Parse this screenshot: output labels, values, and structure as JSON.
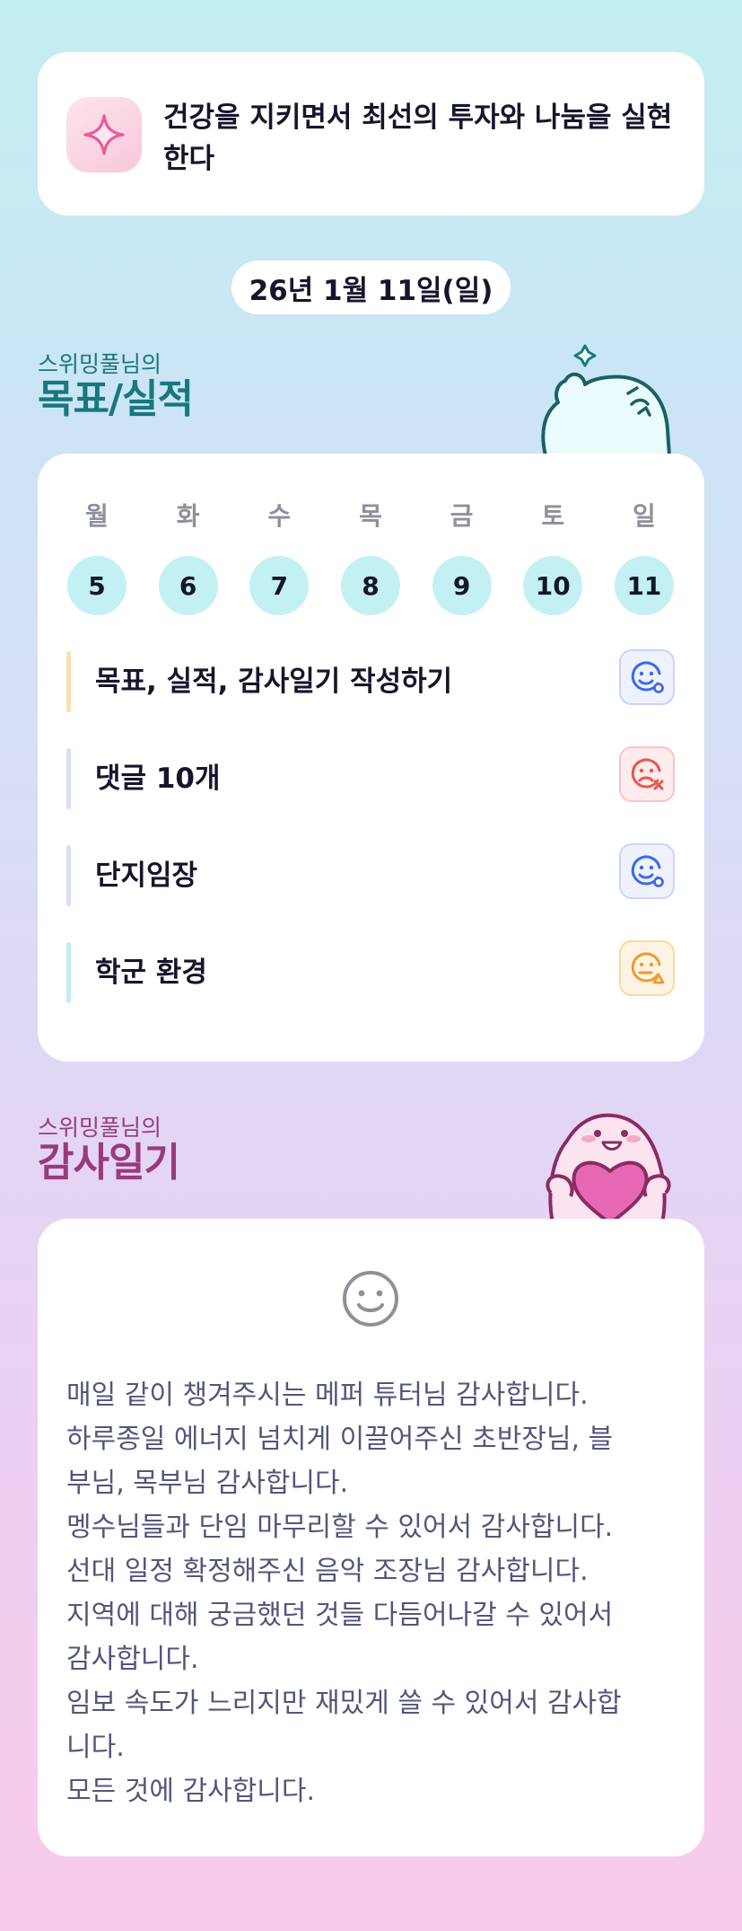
{
  "goal": {
    "icon": "sparkle-icon",
    "text": "건강을 지키면서 최선의 투자와 나눔을 실현한다"
  },
  "date": "26년 1월 11일(일)",
  "goals_section": {
    "subtitle": "스위밍풀님의",
    "title": "목표/실적",
    "mascot": "winking-mascot"
  },
  "week": {
    "days": [
      {
        "name": "월",
        "num": "5"
      },
      {
        "name": "화",
        "num": "6"
      },
      {
        "name": "수",
        "num": "7"
      },
      {
        "name": "목",
        "num": "8"
      },
      {
        "name": "금",
        "num": "9"
      },
      {
        "name": "토",
        "num": "10"
      },
      {
        "name": "일",
        "num": "11"
      }
    ]
  },
  "tasks": [
    {
      "label": "목표, 실적, 감사일기 작성하기",
      "bar_color": "#fbe0b0",
      "status": "done",
      "icon": "smile-circle-icon",
      "badge_bg": "#eef2ff",
      "badge_border": "#c9d4f7",
      "icon_color": "#3d6ae8"
    },
    {
      "label": "댓글 10개",
      "bar_color": "#d8dff7",
      "status": "failed",
      "icon": "sad-x-icon",
      "badge_bg": "#ffecec",
      "badge_border": "#f6c4c4",
      "icon_color": "#e8574f"
    },
    {
      "label": "단지임장",
      "bar_color": "#d8dff7",
      "status": "done",
      "icon": "smile-circle-icon",
      "badge_bg": "#eef2ff",
      "badge_border": "#c9d4f7",
      "icon_color": "#3d6ae8"
    },
    {
      "label": "학군 환경",
      "bar_color": "#c3eef2",
      "status": "partial",
      "icon": "neutral-triangle-icon",
      "badge_bg": "#fff4e4",
      "badge_border": "#f8d8a8",
      "icon_color": "#f29a2e"
    }
  ],
  "diary_section": {
    "subtitle": "스위밍풀님의",
    "title": "감사일기",
    "mascot": "heart-mascot"
  },
  "diary": {
    "icon": "smile-face-icon",
    "lines": [
      "매일 같이 챙겨주시는 메퍼 튜터님 감사합니다.",
      "하루종일 에너지 넘치게 이끌어주신 초반장님, 블",
      "부님, 목부님 감사합니다.",
      "멩수님들과 단임 마무리할 수 있어서 감사합니다.",
      "선대 일정 확정해주신 음악 조장님 감사합니다.",
      "지역에 대해 궁금했던 것들 다듬어나갈 수 있어서",
      "감사합니다.",
      "임보 속도가 느리지만 재밌게 쓸 수 있어서 감사합",
      "니다.",
      "모든 것에 감사합니다."
    ]
  }
}
